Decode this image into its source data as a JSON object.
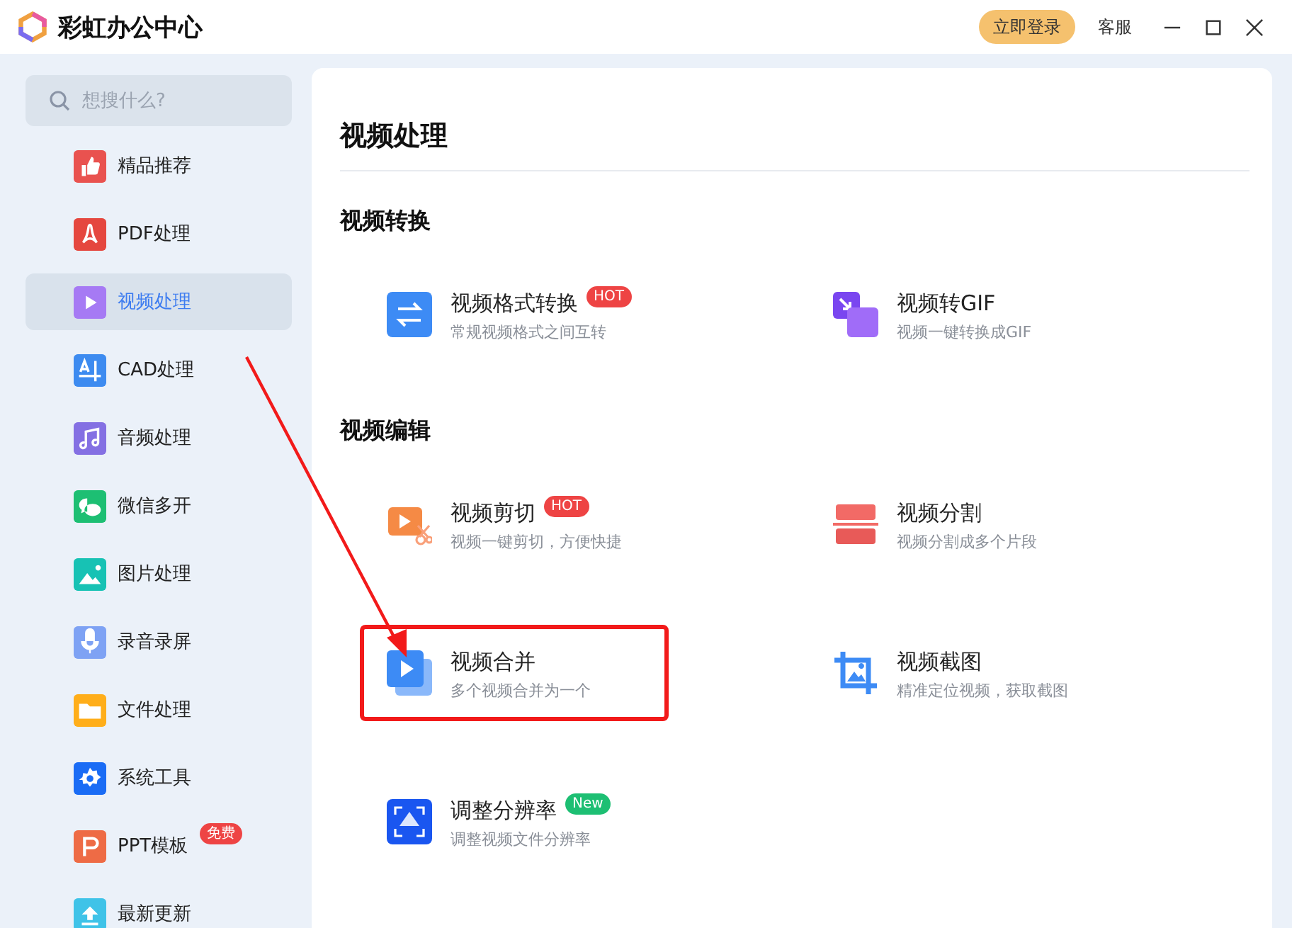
{
  "app": {
    "title": "彩虹办公中心",
    "login_button": "立即登录",
    "service": "客服"
  },
  "search": {
    "placeholder": "想搜什么?"
  },
  "sidebar": {
    "items": [
      {
        "label": "精品推荐",
        "kind": "thumb",
        "selected": false
      },
      {
        "label": "PDF处理",
        "kind": "pdf",
        "selected": false
      },
      {
        "label": "视频处理",
        "kind": "video",
        "selected": true
      },
      {
        "label": "CAD处理",
        "kind": "cad",
        "selected": false
      },
      {
        "label": "音频处理",
        "kind": "music",
        "selected": false
      },
      {
        "label": "微信多开",
        "kind": "chat",
        "selected": false
      },
      {
        "label": "图片处理",
        "kind": "image",
        "selected": false
      },
      {
        "label": "录音录屏",
        "kind": "mic",
        "selected": false
      },
      {
        "label": "文件处理",
        "kind": "folder",
        "selected": false
      },
      {
        "label": "系统工具",
        "kind": "gear",
        "selected": false
      },
      {
        "label": "PPT模板",
        "kind": "ppt",
        "selected": false,
        "badge": {
          "label": "免费",
          "color": "#ee4444"
        }
      },
      {
        "label": "最新更新",
        "kind": "upload",
        "selected": false
      }
    ]
  },
  "page_title": "视频处理",
  "sections": [
    {
      "title": "视频转换",
      "tools": [
        {
          "name": "视频格式转换",
          "desc": "常规视频格式之间互转",
          "kind": "swap",
          "highlighted": false,
          "badge": {
            "label": "HOT",
            "color": "#ee4444"
          }
        },
        {
          "name": "视频转GIF",
          "desc": "视频一键转换成GIF",
          "kind": "gif",
          "highlighted": false
        }
      ]
    },
    {
      "title": "视频编辑",
      "tools": [
        {
          "name": "视频剪切",
          "desc": "视频一键剪切，方便快捷",
          "kind": "cut",
          "highlighted": false,
          "badge": {
            "label": "HOT",
            "color": "#ee4444"
          }
        },
        {
          "name": "视频分割",
          "desc": "视频分割成多个片段",
          "kind": "split",
          "highlighted": false
        },
        {
          "name": "视频合并",
          "desc": "多个视频合并为一个",
          "kind": "merge",
          "highlighted": true
        },
        {
          "name": "视频截图",
          "desc": "精准定位视频，获取截图",
          "kind": "crop",
          "highlighted": false
        },
        {
          "name": "调整分辨率",
          "desc": "调整视频文件分辨率",
          "kind": "resolution",
          "highlighted": false,
          "badge": {
            "label": "New",
            "color": "#1dbf73"
          }
        }
      ]
    }
  ]
}
